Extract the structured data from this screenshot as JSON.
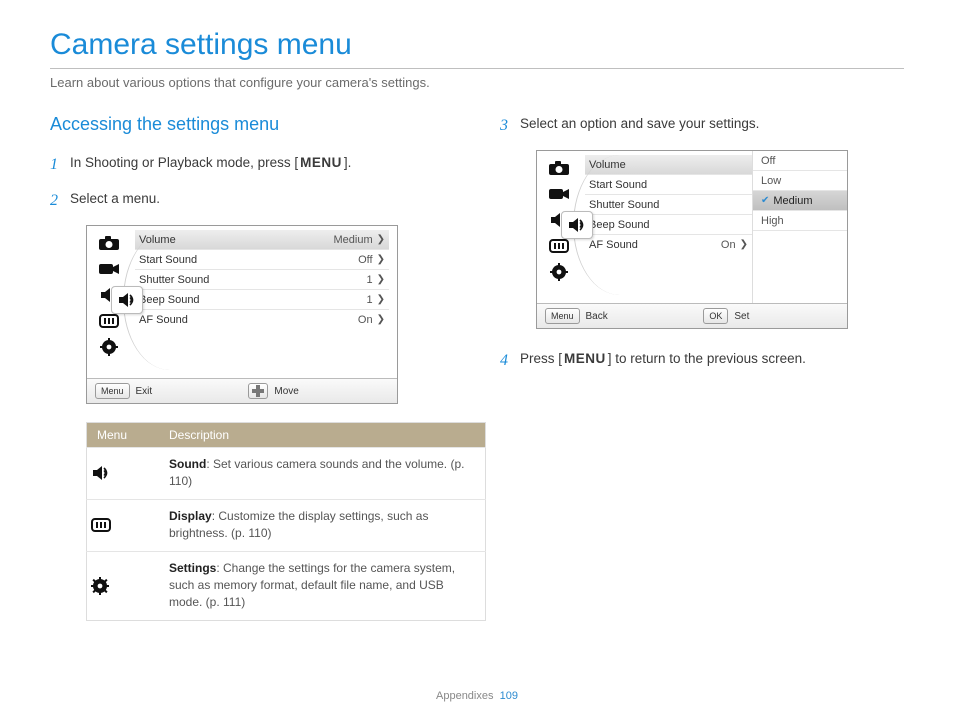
{
  "title": "Camera settings menu",
  "subtitle": "Learn about various options that configure your camera's settings.",
  "heading": "Accessing the settings menu",
  "steps": {
    "s1a": "In Shooting or Playback mode, press [",
    "s1b": "].",
    "menu_label": "MENU",
    "s2": "Select a menu.",
    "s3": "Select an option and save your settings.",
    "s4a": "Press [",
    "s4b": "] to return to the previous screen."
  },
  "screen1": {
    "rows": [
      {
        "label": "Volume",
        "value": "Medium"
      },
      {
        "label": "Start Sound",
        "value": "Off"
      },
      {
        "label": "Shutter Sound",
        "value": "1"
      },
      {
        "label": "Beep Sound",
        "value": "1"
      },
      {
        "label": "AF Sound",
        "value": "On"
      }
    ],
    "footer": {
      "btn": "Menu",
      "btn_label": "Exit",
      "btn2_label": "Move"
    }
  },
  "screen2": {
    "rows": [
      {
        "label": "Volume"
      },
      {
        "label": "Start Sound"
      },
      {
        "label": "Shutter Sound"
      },
      {
        "label": "Beep Sound"
      },
      {
        "label": "AF Sound",
        "value": "On"
      }
    ],
    "options": [
      "Off",
      "Low",
      "Medium",
      "High"
    ],
    "footer": {
      "btn": "Menu",
      "btn_label": "Back",
      "btn2": "OK",
      "btn2_label": "Set"
    }
  },
  "table": {
    "h1": "Menu",
    "h2": "Description",
    "rows": [
      {
        "bold": "Sound",
        "text": ": Set various camera sounds and the volume. (p. 110)"
      },
      {
        "bold": "Display",
        "text": ": Customize the display settings, such as brightness. (p. 110)"
      },
      {
        "bold": "Settings",
        "text": ": Change the settings for the camera system, such as memory format, default file name, and USB mode. (p. 111)"
      }
    ]
  },
  "footer": {
    "section": "Appendixes",
    "page": "109"
  }
}
